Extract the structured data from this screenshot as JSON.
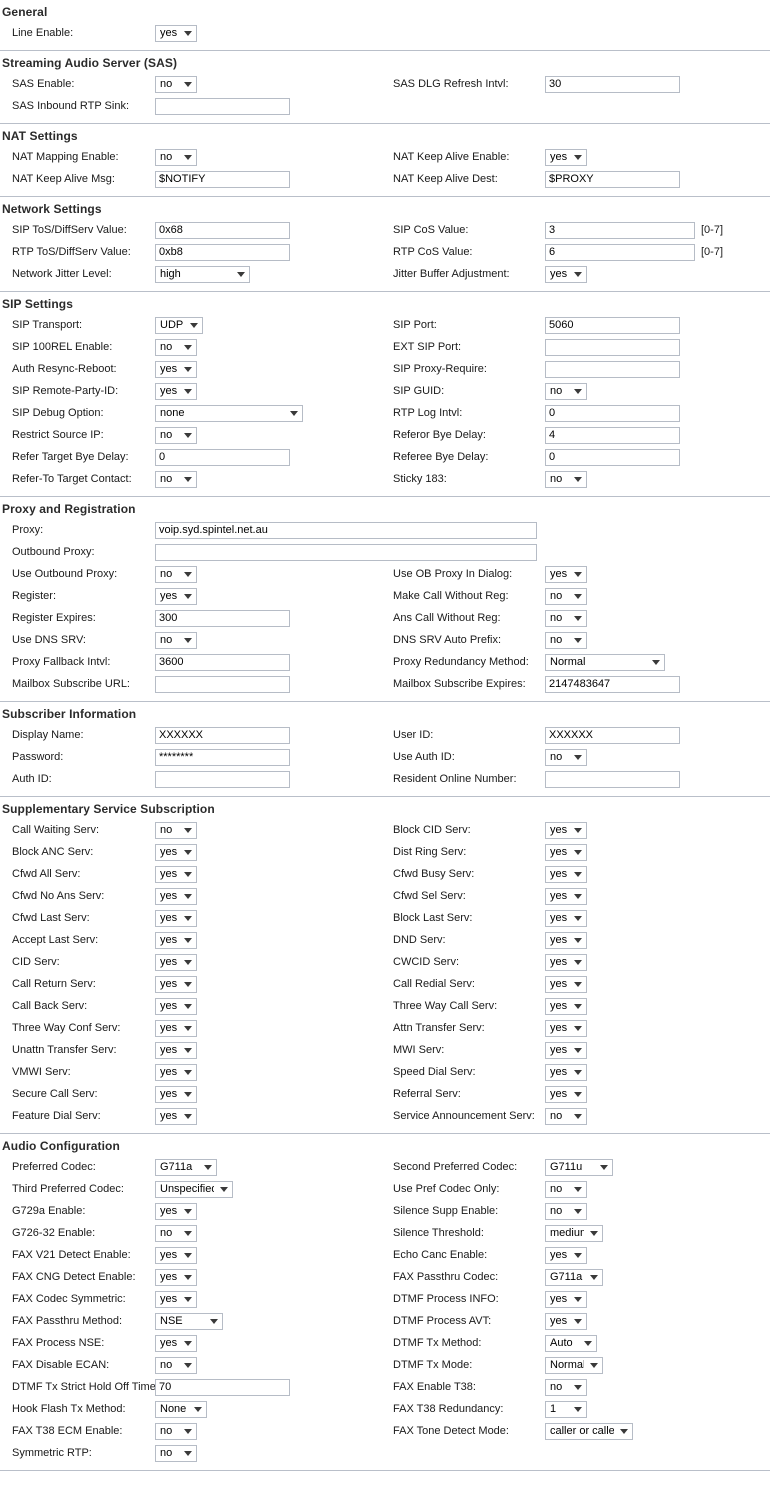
{
  "sections": [
    {
      "title": "General",
      "left": [
        {
          "label": "Line Enable:",
          "type": "select",
          "value": "yes",
          "w": "w42"
        }
      ],
      "right": []
    },
    {
      "title": "Streaming Audio Server (SAS)",
      "left": [
        {
          "label": "SAS Enable:",
          "type": "select",
          "value": "no",
          "w": "w42"
        },
        {
          "label": "SAS Inbound RTP Sink:",
          "type": "text",
          "value": "",
          "w": "w135"
        }
      ],
      "right": [
        {
          "label": "SAS DLG Refresh Intvl:",
          "type": "text",
          "value": "30",
          "w": "w135"
        }
      ]
    },
    {
      "title": "NAT Settings",
      "left": [
        {
          "label": "NAT Mapping Enable:",
          "type": "select",
          "value": "no",
          "w": "w42"
        },
        {
          "label": "NAT Keep Alive Msg:",
          "type": "text",
          "value": "$NOTIFY",
          "w": "w135"
        }
      ],
      "right": [
        {
          "label": "NAT Keep Alive Enable:",
          "type": "select",
          "value": "yes",
          "w": "w42"
        },
        {
          "label": "NAT Keep Alive Dest:",
          "type": "text",
          "value": "$PROXY",
          "w": "w135"
        }
      ]
    },
    {
      "title": "Network Settings",
      "left": [
        {
          "label": "SIP ToS/DiffServ Value:",
          "type": "text",
          "value": "0x68",
          "w": "w135"
        },
        {
          "label": "RTP ToS/DiffServ Value:",
          "type": "text",
          "value": "0xb8",
          "w": "w135"
        },
        {
          "label": "Network Jitter Level:",
          "type": "select",
          "value": "high",
          "w": "w95"
        }
      ],
      "right": [
        {
          "label": "SIP CoS Value:",
          "type": "text",
          "value": "3",
          "w": "w52",
          "suffix": "[0-7]"
        },
        {
          "label": "RTP CoS Value:",
          "type": "text",
          "value": "6",
          "w": "w52",
          "suffix": "[0-7]"
        },
        {
          "label": "Jitter Buffer Adjustment:",
          "type": "select",
          "value": "yes",
          "w": "w42"
        }
      ]
    },
    {
      "title": "SIP Settings",
      "left": [
        {
          "label": "SIP Transport:",
          "type": "select",
          "value": "UDP",
          "w": "w48"
        },
        {
          "label": "SIP 100REL Enable:",
          "type": "select",
          "value": "no",
          "w": "w42"
        },
        {
          "label": "Auth Resync-Reboot:",
          "type": "select",
          "value": "yes",
          "w": "w42"
        },
        {
          "label": "SIP Remote-Party-ID:",
          "type": "select",
          "value": "yes",
          "w": "w42"
        },
        {
          "label": "SIP Debug Option:",
          "type": "select",
          "value": "none",
          "w": "w148"
        },
        {
          "label": "Restrict Source IP:",
          "type": "select",
          "value": "no",
          "w": "w42"
        },
        {
          "label": "Refer Target Bye Delay:",
          "type": "text",
          "value": "0",
          "w": "w135"
        },
        {
          "label": "Refer-To Target Contact:",
          "type": "select",
          "value": "no",
          "w": "w42"
        }
      ],
      "right": [
        {
          "label": "SIP Port:",
          "type": "text",
          "value": "5060",
          "w": "w135"
        },
        {
          "label": "EXT SIP Port:",
          "type": "text",
          "value": "",
          "w": "w135"
        },
        {
          "label": "SIP Proxy-Require:",
          "type": "text",
          "value": "",
          "w": "w135"
        },
        {
          "label": "SIP GUID:",
          "type": "select",
          "value": "no",
          "w": "w42"
        },
        {
          "label": "RTP Log Intvl:",
          "type": "text",
          "value": "0",
          "w": "w135"
        },
        {
          "label": "Referor Bye Delay:",
          "type": "text",
          "value": "4",
          "w": "w135"
        },
        {
          "label": "Referee Bye Delay:",
          "type": "text",
          "value": "0",
          "w": "w135"
        },
        {
          "label": "Sticky 183:",
          "type": "select",
          "value": "no",
          "w": "w42"
        }
      ]
    },
    {
      "title": "Proxy and Registration",
      "left": [
        {
          "label": "Proxy:",
          "type": "text",
          "value": "voip.syd.spintel.net.au",
          "w": "w382",
          "full": true
        },
        {
          "label": "Outbound Proxy:",
          "type": "text",
          "value": "",
          "w": "w382",
          "full": true
        },
        {
          "label": "Use Outbound Proxy:",
          "type": "select",
          "value": "no",
          "w": "w42"
        },
        {
          "label": "Register:",
          "type": "select",
          "value": "yes",
          "w": "w42"
        },
        {
          "label": "Register Expires:",
          "type": "text",
          "value": "300",
          "w": "w135"
        },
        {
          "label": "Use DNS SRV:",
          "type": "select",
          "value": "no",
          "w": "w42"
        },
        {
          "label": "Proxy Fallback Intvl:",
          "type": "text",
          "value": "3600",
          "w": "w135"
        },
        {
          "label": "Mailbox Subscribe URL:",
          "type": "text",
          "value": "",
          "w": "w135"
        }
      ],
      "right": [
        {
          "type": "spacer"
        },
        {
          "type": "spacer"
        },
        {
          "label": "Use OB Proxy In Dialog:",
          "type": "select",
          "value": "yes",
          "w": "w42"
        },
        {
          "label": "Make Call Without Reg:",
          "type": "select",
          "value": "no",
          "w": "w42"
        },
        {
          "label": "Ans Call Without Reg:",
          "type": "select",
          "value": "no",
          "w": "w42"
        },
        {
          "label": "DNS SRV Auto Prefix:",
          "type": "select",
          "value": "no",
          "w": "w42"
        },
        {
          "label": "Proxy Redundancy Method:",
          "type": "select",
          "value": "Normal",
          "w": "w120"
        },
        {
          "label": "Mailbox Subscribe Expires:",
          "type": "text",
          "value": "2147483647",
          "w": "w135"
        }
      ]
    },
    {
      "title": "Subscriber Information",
      "left": [
        {
          "label": "Display Name:",
          "type": "text",
          "value": "XXXXXX",
          "w": "w135"
        },
        {
          "label": "Password:",
          "type": "text",
          "value": "********",
          "w": "w135"
        },
        {
          "label": "Auth ID:",
          "type": "text",
          "value": "",
          "w": "w135"
        }
      ],
      "right": [
        {
          "label": "User ID:",
          "type": "text",
          "value": "XXXXXX",
          "w": "w135"
        },
        {
          "label": "Use Auth ID:",
          "type": "select",
          "value": "no",
          "w": "w42"
        },
        {
          "label": "Resident Online Number:",
          "type": "text",
          "value": "",
          "w": "w135"
        }
      ]
    },
    {
      "title": "Supplementary Service Subscription",
      "left": [
        {
          "label": "Call Waiting Serv:",
          "type": "select",
          "value": "no",
          "w": "w42"
        },
        {
          "label": "Block ANC Serv:",
          "type": "select",
          "value": "yes",
          "w": "w42"
        },
        {
          "label": "Cfwd All Serv:",
          "type": "select",
          "value": "yes",
          "w": "w42"
        },
        {
          "label": "Cfwd No Ans Serv:",
          "type": "select",
          "value": "yes",
          "w": "w42"
        },
        {
          "label": "Cfwd Last Serv:",
          "type": "select",
          "value": "yes",
          "w": "w42"
        },
        {
          "label": "Accept Last Serv:",
          "type": "select",
          "value": "yes",
          "w": "w42"
        },
        {
          "label": "CID Serv:",
          "type": "select",
          "value": "yes",
          "w": "w42"
        },
        {
          "label": "Call Return Serv:",
          "type": "select",
          "value": "yes",
          "w": "w42"
        },
        {
          "label": "Call Back Serv:",
          "type": "select",
          "value": "yes",
          "w": "w42"
        },
        {
          "label": "Three Way Conf Serv:",
          "type": "select",
          "value": "yes",
          "w": "w42"
        },
        {
          "label": "Unattn Transfer Serv:",
          "type": "select",
          "value": "yes",
          "w": "w42"
        },
        {
          "label": "VMWI Serv:",
          "type": "select",
          "value": "yes",
          "w": "w42"
        },
        {
          "label": "Secure Call Serv:",
          "type": "select",
          "value": "yes",
          "w": "w42"
        },
        {
          "label": "Feature Dial Serv:",
          "type": "select",
          "value": "yes",
          "w": "w42"
        }
      ],
      "right": [
        {
          "label": "Block CID Serv:",
          "type": "select",
          "value": "yes",
          "w": "w42"
        },
        {
          "label": "Dist Ring Serv:",
          "type": "select",
          "value": "yes",
          "w": "w42"
        },
        {
          "label": "Cfwd Busy Serv:",
          "type": "select",
          "value": "yes",
          "w": "w42"
        },
        {
          "label": "Cfwd Sel Serv:",
          "type": "select",
          "value": "yes",
          "w": "w42"
        },
        {
          "label": "Block Last Serv:",
          "type": "select",
          "value": "yes",
          "w": "w42"
        },
        {
          "label": "DND Serv:",
          "type": "select",
          "value": "yes",
          "w": "w42"
        },
        {
          "label": "CWCID Serv:",
          "type": "select",
          "value": "yes",
          "w": "w42"
        },
        {
          "label": "Call Redial Serv:",
          "type": "select",
          "value": "yes",
          "w": "w42"
        },
        {
          "label": "Three Way Call Serv:",
          "type": "select",
          "value": "yes",
          "w": "w42"
        },
        {
          "label": "Attn Transfer Serv:",
          "type": "select",
          "value": "yes",
          "w": "w42"
        },
        {
          "label": "MWI Serv:",
          "type": "select",
          "value": "yes",
          "w": "w42"
        },
        {
          "label": "Speed Dial Serv:",
          "type": "select",
          "value": "yes",
          "w": "w42"
        },
        {
          "label": "Referral Serv:",
          "type": "select",
          "value": "yes",
          "w": "w42"
        },
        {
          "label": "Service Announcement Serv:",
          "type": "select",
          "value": "no",
          "w": "w42"
        }
      ]
    },
    {
      "title": "Audio Configuration",
      "left": [
        {
          "label": "Preferred Codec:",
          "type": "select",
          "value": "G711a",
          "w": "w62"
        },
        {
          "label": "Third Preferred Codec:",
          "type": "select",
          "value": "Unspecified",
          "w": "w78"
        },
        {
          "label": "G729a Enable:",
          "type": "select",
          "value": "yes",
          "w": "w42"
        },
        {
          "label": "G726-32 Enable:",
          "type": "select",
          "value": "no",
          "w": "w42"
        },
        {
          "label": "FAX V21 Detect Enable:",
          "type": "select",
          "value": "yes",
          "w": "w42"
        },
        {
          "label": "FAX CNG Detect Enable:",
          "type": "select",
          "value": "yes",
          "w": "w42"
        },
        {
          "label": "FAX Codec Symmetric:",
          "type": "select",
          "value": "yes",
          "w": "w42"
        },
        {
          "label": "FAX Passthru Method:",
          "type": "select",
          "value": "NSE",
          "w": "w68"
        },
        {
          "label": "FAX Process NSE:",
          "type": "select",
          "value": "yes",
          "w": "w42"
        },
        {
          "label": "FAX Disable ECAN:",
          "type": "select",
          "value": "no",
          "w": "w42"
        },
        {
          "label": "DTMF Tx Strict Hold Off Time:",
          "type": "text",
          "value": "70",
          "w": "w135"
        },
        {
          "label": "Hook Flash Tx Method:",
          "type": "select",
          "value": "None",
          "w": "w52"
        },
        {
          "label": "FAX T38 ECM Enable:",
          "type": "select",
          "value": "no",
          "w": "w42"
        },
        {
          "label": "Symmetric RTP:",
          "type": "select",
          "value": "no",
          "w": "w42"
        }
      ],
      "right": [
        {
          "label": "Second Preferred Codec:",
          "type": "select",
          "value": "G711u",
          "w": "w68"
        },
        {
          "label": "Use Pref Codec Only:",
          "type": "select",
          "value": "no",
          "w": "w42"
        },
        {
          "label": "Silence Supp Enable:",
          "type": "select",
          "value": "no",
          "w": "w42"
        },
        {
          "label": "Silence Threshold:",
          "type": "select",
          "value": "medium",
          "w": "w58"
        },
        {
          "label": "Echo Canc Enable:",
          "type": "select",
          "value": "yes",
          "w": "w42"
        },
        {
          "label": "FAX Passthru Codec:",
          "type": "select",
          "value": "G711a",
          "w": "w58"
        },
        {
          "label": "DTMF Process INFO:",
          "type": "select",
          "value": "yes",
          "w": "w42"
        },
        {
          "label": "DTMF Process AVT:",
          "type": "select",
          "value": "yes",
          "w": "w42"
        },
        {
          "label": "DTMF Tx Method:",
          "type": "select",
          "value": "Auto",
          "w": "w52"
        },
        {
          "label": "DTMF Tx Mode:",
          "type": "select",
          "value": "Normal",
          "w": "w58"
        },
        {
          "label": "FAX Enable T38:",
          "type": "select",
          "value": "no",
          "w": "w42"
        },
        {
          "label": "FAX T38 Redundancy:",
          "type": "select",
          "value": "1",
          "w": "w42"
        },
        {
          "label": "FAX Tone Detect Mode:",
          "type": "select",
          "value": "caller or callee",
          "w": "w88"
        }
      ]
    }
  ]
}
